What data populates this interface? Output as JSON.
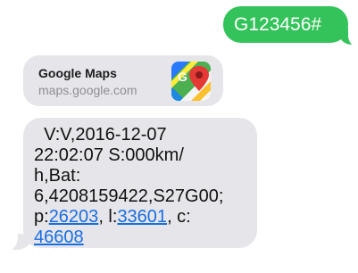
{
  "messages": {
    "sent": {
      "text": "G123456#"
    },
    "link_preview": {
      "title": "Google Maps",
      "domain": "maps.google.com",
      "icon": "google-maps-icon"
    },
    "received": {
      "line1": "V:V,2016-12-07",
      "line2": "22:02:07 S:000km/",
      "line3": "h,Bat:",
      "line4": "6,4208159422,S27G00;",
      "p_prefix": "p:",
      "p_value": "26203",
      "l_prefix": ", l:",
      "l_value": "33601",
      "c_prefix": ", c:",
      "c_value": "46608"
    }
  },
  "colors": {
    "sent_bubble": "#33c35a",
    "received_bubble": "#e5e5ea",
    "link": "#1a6fe0"
  }
}
